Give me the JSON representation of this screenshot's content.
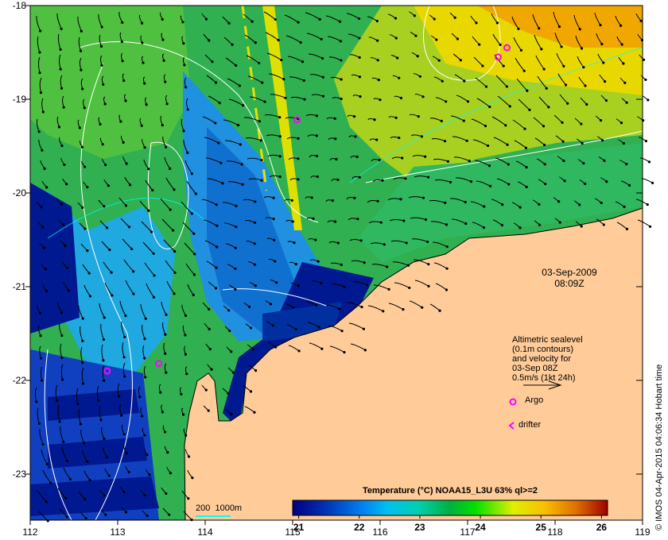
{
  "map": {
    "lon_range": [
      112,
      119
    ],
    "lat_range": [
      -23.5,
      -18
    ],
    "x_ticks": [
      "112",
      "113",
      "114",
      "115",
      "116",
      "117",
      "118",
      "119"
    ],
    "y_ticks": [
      "-18",
      "-19",
      "-20",
      "-21",
      "-22",
      "-23"
    ],
    "colors": {
      "land": "#ffcc99",
      "argo": "#ff00ff",
      "drifter": "#ff00ff",
      "bathymetry": "#00ffff",
      "sealevel_contour": "#ffffff"
    }
  },
  "timestamp": {
    "date": "03-Sep-2009",
    "time": "08:09Z"
  },
  "legend": {
    "lines": [
      "Altimetric sealevel",
      "(0.1m contours)",
      "and velocity for",
      "03-Sep 08Z",
      "0.5m/s (1kt 24h)"
    ],
    "argo_label": "Argo",
    "drifter_label": "drifter"
  },
  "scale_bar": {
    "label": "200  1000m"
  },
  "colorbar": {
    "title": "Temperature (°C) NOAA15_L3U 63% ql>=2",
    "ticks": [
      "21",
      "22",
      "23",
      "24",
      "25",
      "26"
    ],
    "range": [
      20.9,
      26.1
    ]
  },
  "argo_floats": [
    {
      "lon": 117.45,
      "lat": -18.45
    },
    {
      "lon": 117.35,
      "lat": -18.55
    },
    {
      "lon": 115.05,
      "lat": -19.22
    },
    {
      "lon": 113.47,
      "lat": -21.82
    },
    {
      "lon": 112.88,
      "lat": -21.9
    }
  ],
  "credit": "© IMOS 04-Apr-2015 04:06:34 Hobart time"
}
